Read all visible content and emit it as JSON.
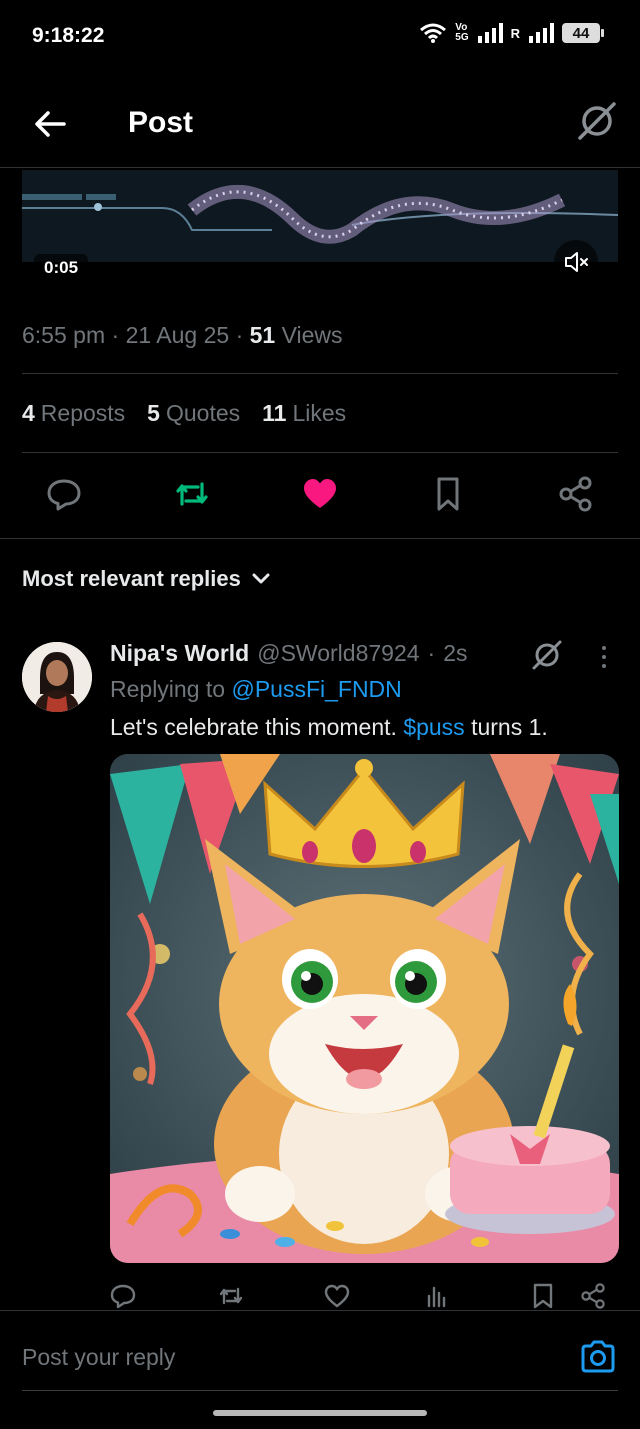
{
  "status_bar": {
    "time": "9:18:22",
    "network_top": "Vo",
    "network_bottom": "5G",
    "roaming": "R",
    "battery": "44",
    "icons": [
      "wifi-icon",
      "signal-icon",
      "signal-icon",
      "battery-icon"
    ]
  },
  "header": {
    "title": "Post",
    "back_icon": "back-arrow-icon",
    "grok_icon": "grok-icon"
  },
  "video": {
    "time": "0:05",
    "mute_icon": "volume-muted-icon"
  },
  "meta": {
    "time": "6:55 pm",
    "sep1": "·",
    "date": "21 Aug 25",
    "sep2": "·",
    "views_count": "51",
    "views_label": "Views"
  },
  "stats": [
    {
      "count": "4",
      "label": "Reposts"
    },
    {
      "count": "5",
      "label": "Quotes"
    },
    {
      "count": "11",
      "label": "Likes"
    }
  ],
  "actions": {
    "icons": [
      "reply-icon",
      "repost-icon",
      "like-icon",
      "bookmark-icon",
      "share-icon"
    ],
    "colors": {
      "repost": "#00ba7c",
      "like": "#f91880",
      "default": "#71767b"
    }
  },
  "sort": {
    "label": "Most relevant replies"
  },
  "reply": {
    "name": "Nipa's World",
    "handle": "@SWorld87924",
    "dot": "·",
    "time": "2s",
    "replying_prefix": "Replying to",
    "replying_to": "@PussFi_FNDN",
    "text_before": "Let's celebrate this moment.",
    "cashtag": "$puss",
    "text_after": "turns 1.",
    "accent": "#1d9bf0"
  },
  "reply_actions": {
    "icons": [
      "reply-icon",
      "repost-icon",
      "like-icon",
      "views-icon",
      "bookmark-icon",
      "share-icon"
    ]
  },
  "composer": {
    "placeholder": "Post your reply",
    "camera_icon": "camera-icon"
  }
}
